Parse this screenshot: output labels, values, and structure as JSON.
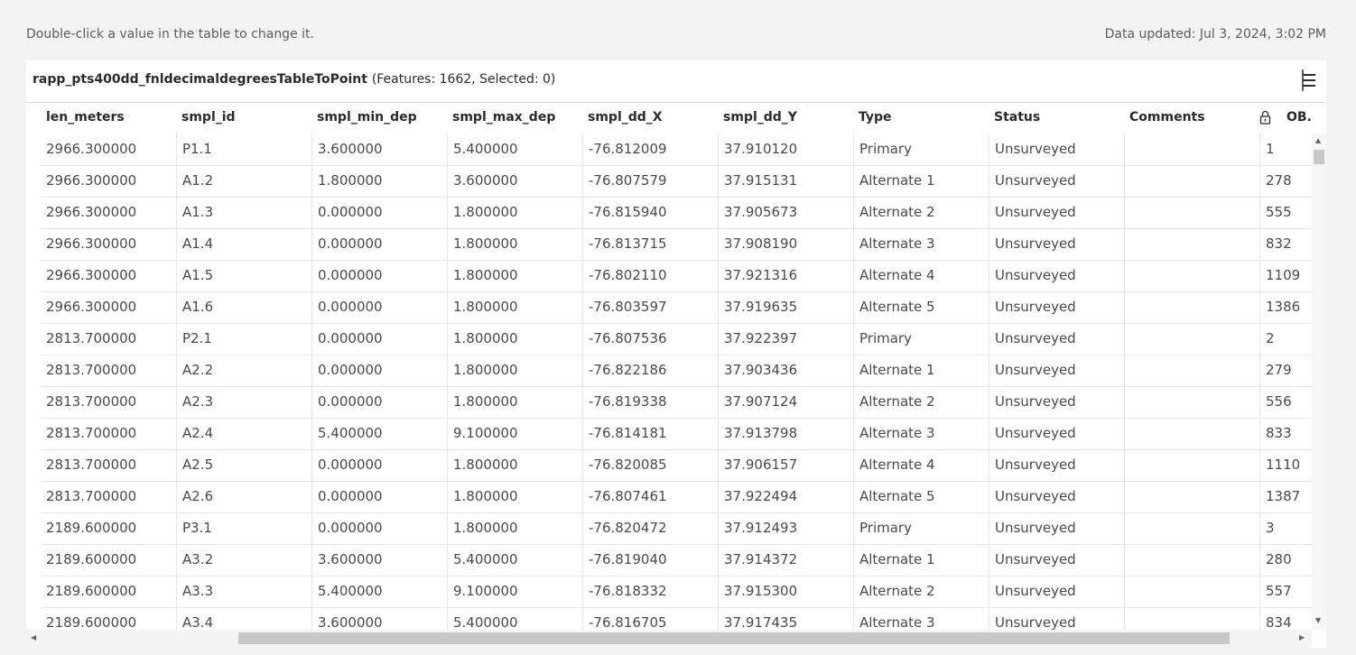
{
  "top": {
    "hint": "Double-click a value in the table to change it.",
    "updated": "Data updated: Jul 3, 2024, 3:02 PM"
  },
  "table": {
    "name": "rapp_pts400dd_fnldecimaldegreesTableToPoint",
    "count_text": "(Features: 1662, Selected: 0)",
    "menu_icon": "menu-icon",
    "lock_icon": "lock-icon",
    "columns": [
      "len_meters",
      "smpl_id",
      "smpl_min_dep",
      "smpl_max_dep",
      "smpl_dd_X",
      "smpl_dd_Y",
      "Type",
      "Status",
      "Comments",
      "OB."
    ],
    "rows": [
      [
        "2966.300000",
        "P1.1",
        "3.600000",
        "5.400000",
        "-76.812009",
        "37.910120",
        "Primary",
        "Unsurveyed",
        "",
        "1"
      ],
      [
        "2966.300000",
        "A1.2",
        "1.800000",
        "3.600000",
        "-76.807579",
        "37.915131",
        "Alternate 1",
        "Unsurveyed",
        "",
        "278"
      ],
      [
        "2966.300000",
        "A1.3",
        "0.000000",
        "1.800000",
        "-76.815940",
        "37.905673",
        "Alternate 2",
        "Unsurveyed",
        "",
        "555"
      ],
      [
        "2966.300000",
        "A1.4",
        "0.000000",
        "1.800000",
        "-76.813715",
        "37.908190",
        "Alternate 3",
        "Unsurveyed",
        "",
        "832"
      ],
      [
        "2966.300000",
        "A1.5",
        "0.000000",
        "1.800000",
        "-76.802110",
        "37.921316",
        "Alternate 4",
        "Unsurveyed",
        "",
        "1109"
      ],
      [
        "2966.300000",
        "A1.6",
        "0.000000",
        "1.800000",
        "-76.803597",
        "37.919635",
        "Alternate 5",
        "Unsurveyed",
        "",
        "1386"
      ],
      [
        "2813.700000",
        "P2.1",
        "0.000000",
        "1.800000",
        "-76.807536",
        "37.922397",
        "Primary",
        "Unsurveyed",
        "",
        "2"
      ],
      [
        "2813.700000",
        "A2.2",
        "0.000000",
        "1.800000",
        "-76.822186",
        "37.903436",
        "Alternate 1",
        "Unsurveyed",
        "",
        "279"
      ],
      [
        "2813.700000",
        "A2.3",
        "0.000000",
        "1.800000",
        "-76.819338",
        "37.907124",
        "Alternate 2",
        "Unsurveyed",
        "",
        "556"
      ],
      [
        "2813.700000",
        "A2.4",
        "5.400000",
        "9.100000",
        "-76.814181",
        "37.913798",
        "Alternate 3",
        "Unsurveyed",
        "",
        "833"
      ],
      [
        "2813.700000",
        "A2.5",
        "0.000000",
        "1.800000",
        "-76.820085",
        "37.906157",
        "Alternate 4",
        "Unsurveyed",
        "",
        "1110"
      ],
      [
        "2813.700000",
        "A2.6",
        "0.000000",
        "1.800000",
        "-76.807461",
        "37.922494",
        "Alternate 5",
        "Unsurveyed",
        "",
        "1387"
      ],
      [
        "2189.600000",
        "P3.1",
        "0.000000",
        "1.800000",
        "-76.820472",
        "37.912493",
        "Primary",
        "Unsurveyed",
        "",
        "3"
      ],
      [
        "2189.600000",
        "A3.2",
        "3.600000",
        "5.400000",
        "-76.819040",
        "37.914372",
        "Alternate 1",
        "Unsurveyed",
        "",
        "280"
      ],
      [
        "2189.600000",
        "A3.3",
        "5.400000",
        "9.100000",
        "-76.818332",
        "37.915300",
        "Alternate 2",
        "Unsurveyed",
        "",
        "557"
      ],
      [
        "2189.600000",
        "A3.4",
        "3.600000",
        "5.400000",
        "-76.816705",
        "37.917435",
        "Alternate 3",
        "Unsurveyed",
        "",
        "834"
      ]
    ]
  },
  "scrollbars": {
    "up": "▲",
    "down": "▼",
    "left": "◀",
    "right": "▶"
  }
}
